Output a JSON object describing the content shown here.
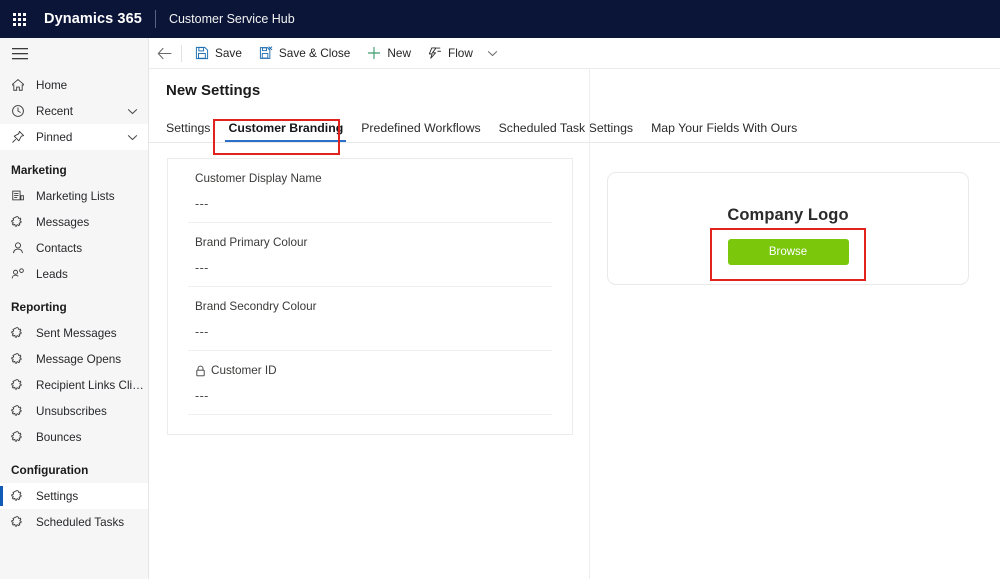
{
  "topbar": {
    "waffle_icon": "app-launcher-grid-icon",
    "brand": "Dynamics 365",
    "app_name": "Customer Service Hub"
  },
  "sidebar": {
    "hamburger_icon": "hamburger-menu-icon",
    "primary": [
      {
        "label": "Home",
        "icon": "home-icon",
        "chevron": false,
        "selected": false
      },
      {
        "label": "Recent",
        "icon": "clock-icon",
        "chevron": true,
        "selected": false
      },
      {
        "label": "Pinned",
        "icon": "pin-icon",
        "chevron": true,
        "selected": false
      }
    ],
    "groups": [
      {
        "header": "Marketing",
        "items": [
          {
            "label": "Marketing Lists",
            "icon": "list-icon",
            "selected": false
          },
          {
            "label": "Messages",
            "icon": "puzzle-icon",
            "selected": false
          },
          {
            "label": "Contacts",
            "icon": "person-icon",
            "selected": false
          },
          {
            "label": "Leads",
            "icon": "leads-icon",
            "selected": false
          }
        ]
      },
      {
        "header": "Reporting",
        "items": [
          {
            "label": "Sent Messages",
            "icon": "puzzle-icon",
            "selected": false
          },
          {
            "label": "Message Opens",
            "icon": "puzzle-icon",
            "selected": false
          },
          {
            "label": "Recipient Links Clicked",
            "icon": "puzzle-icon",
            "selected": false
          },
          {
            "label": "Unsubscribes",
            "icon": "puzzle-icon",
            "selected": false
          },
          {
            "label": "Bounces",
            "icon": "puzzle-icon",
            "selected": false
          }
        ]
      },
      {
        "header": "Configuration",
        "items": [
          {
            "label": "Settings",
            "icon": "puzzle-icon",
            "selected": true
          },
          {
            "label": "Scheduled Tasks",
            "icon": "puzzle-icon",
            "selected": false
          }
        ]
      }
    ]
  },
  "commandbar": {
    "back_icon": "back-arrow-icon",
    "buttons": [
      {
        "label": "Save",
        "icon": "save-disk-icon"
      },
      {
        "label": "Save & Close",
        "icon": "save-close-icon"
      },
      {
        "label": "New",
        "icon": "plus-icon"
      },
      {
        "label": "Flow",
        "icon": "flow-icon"
      }
    ],
    "flow_chevron_icon": "chevron-down-icon"
  },
  "main": {
    "page_title": "New Settings",
    "tabs": [
      {
        "label": "Settings",
        "active": false
      },
      {
        "label": "Customer Branding",
        "active": true
      },
      {
        "label": "Predefined Workflows",
        "active": false
      },
      {
        "label": "Scheduled Task Settings",
        "active": false
      },
      {
        "label": "Map Your Fields With Ours",
        "active": false
      }
    ],
    "fields": [
      {
        "label": "Customer Display Name",
        "value": "---",
        "locked": false
      },
      {
        "label": "Brand Primary Colour",
        "value": "---",
        "locked": false
      },
      {
        "label": "Brand Secondry Colour",
        "value": "---",
        "locked": false
      },
      {
        "label": "Customer ID",
        "value": "---",
        "locked": true,
        "lock_icon": "lock-icon"
      }
    ],
    "logo_panel": {
      "title": "Company Logo",
      "browse_label": "Browse"
    }
  },
  "colors": {
    "topbar_bg": "#0b1538",
    "accent_blue": "#2a6fc9",
    "selected_bar": "#0f5bb5",
    "browse_green": "#7ac70c",
    "annotation_red": "#e1231f",
    "sidebar_bg": "#f6f6f6"
  },
  "annotations": [
    {
      "name": "customer-branding-tab-highlight"
    },
    {
      "name": "browse-button-highlight"
    }
  ]
}
